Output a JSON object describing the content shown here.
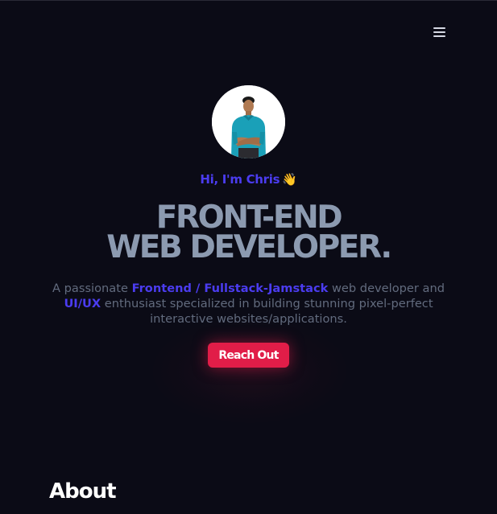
{
  "header": {
    "menu_icon": "hamburger-menu-icon"
  },
  "hero": {
    "avatar_alt": "Chris",
    "greeting": "Hi, I'm Chris",
    "greeting_emoji": "👋",
    "headline_line1": "FRONT-END",
    "headline_line2": "WEB DEVELOPER.",
    "bio": {
      "part1": "A passionate ",
      "highlight1": "Frontend / Fullstack-Jamstack",
      "part2": " web developer and",
      "highlight2": "UI/UX",
      "part3": " enthusiast specialized in building stunning pixel-perfect",
      "part4": "interactive websites/applications."
    },
    "cta_label": "Reach Out"
  },
  "sections": {
    "about_title": "About"
  },
  "colors": {
    "background": "#0b0b16",
    "accent": "#4b3cf0",
    "headline": "#8c9ab0",
    "body_text": "#626b7e",
    "cta": "#e11d48"
  }
}
